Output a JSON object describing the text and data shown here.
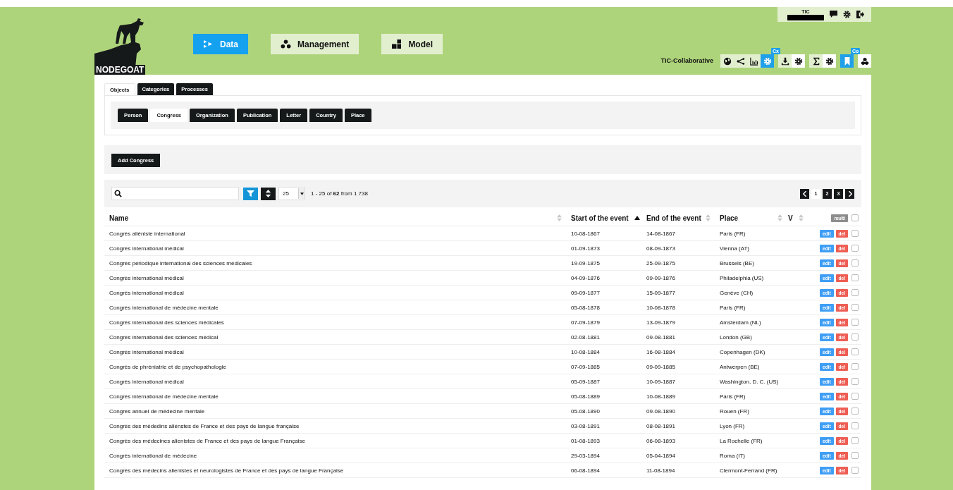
{
  "logo": "NODEGOAT",
  "user": {
    "name": "TIC"
  },
  "nav": [
    {
      "label": "Data",
      "kind": "data",
      "selected": true
    },
    {
      "label": "Management",
      "kind": "management",
      "selected": false
    },
    {
      "label": "Model",
      "kind": "model",
      "selected": false
    }
  ],
  "project": "TIC-Collaborative",
  "toolbar_groups": [
    [
      {
        "kind": "globe",
        "active": false
      },
      {
        "kind": "network",
        "active": false
      },
      {
        "kind": "chart",
        "active": false
      },
      {
        "kind": "gear",
        "active": true,
        "badge": "Cx"
      }
    ],
    [
      {
        "kind": "download",
        "active": false
      },
      {
        "kind": "gear",
        "active": false
      }
    ],
    [
      {
        "kind": "sigma",
        "active": false
      },
      {
        "kind": "gear",
        "active": false
      }
    ],
    [
      {
        "kind": "bookmark",
        "active": true,
        "badge": "Co"
      }
    ],
    [
      {
        "kind": "cubes",
        "active": false
      }
    ]
  ],
  "type_tabs": [
    {
      "label": "Objects",
      "selected": true
    },
    {
      "label": "Categories",
      "selected": false
    },
    {
      "label": "Processes",
      "selected": false
    }
  ],
  "object_tabs": [
    {
      "label": "Person",
      "selected": false
    },
    {
      "label": "Congress",
      "selected": true
    },
    {
      "label": "Organization",
      "selected": false
    },
    {
      "label": "Publication",
      "selected": false
    },
    {
      "label": "Letter",
      "selected": false
    },
    {
      "label": "Country",
      "selected": false
    },
    {
      "label": "Place",
      "selected": false
    }
  ],
  "add_button": "Add Congress",
  "page_size": "25",
  "result_summary": "1 - 25 of **62** from 1 738",
  "pages": [
    {
      "label": "1",
      "selected": true
    },
    {
      "label": "2",
      "selected": false
    },
    {
      "label": "3",
      "selected": false
    }
  ],
  "columns": [
    {
      "label": "Name",
      "sorted_ascending": false
    },
    {
      "label": "Start of the event",
      "sorted_ascending": true
    },
    {
      "label": "End of the event",
      "sorted_ascending": false
    },
    {
      "label": "Place",
      "sorted_ascending": false
    },
    {
      "label": "V",
      "sorted_ascending": false
    }
  ],
  "multi_button": "multi",
  "select_all_checked": false,
  "rows": [
    {
      "cells": [
        "Congrès aliéniste international",
        "10-08-1867",
        "14-08-1867",
        "Paris (FR)"
      ],
      "edit": "edit",
      "delete": "del",
      "checked": false
    },
    {
      "cells": [
        "Congrès international médical",
        "01-09-1873",
        "08-09-1873",
        "Vienna (AT)"
      ],
      "edit": "edit",
      "delete": "del",
      "checked": false
    },
    {
      "cells": [
        "Congrès périodique international des sciences médicales",
        "19-09-1875",
        "25-09-1875",
        "Brussels (BE)"
      ],
      "edit": "edit",
      "delete": "del",
      "checked": false
    },
    {
      "cells": [
        "Congrès international médical",
        "04-09-1876",
        "09-09-1876",
        "Philadelphia (US)"
      ],
      "edit": "edit",
      "delete": "del",
      "checked": false
    },
    {
      "cells": [
        "Congrès international médical",
        "09-09-1877",
        "15-09-1877",
        "Genève (CH)"
      ],
      "edit": "edit",
      "delete": "del",
      "checked": false
    },
    {
      "cells": [
        "Congrès international de médecine mentale",
        "05-08-1878",
        "10-08-1878",
        "Paris (FR)"
      ],
      "edit": "edit",
      "delete": "del",
      "checked": false
    },
    {
      "cells": [
        "Congrès international des sciences médicales",
        "07-09-1879",
        "13-09-1879",
        "Amsterdam (NL)"
      ],
      "edit": "edit",
      "delete": "del",
      "checked": false
    },
    {
      "cells": [
        "Congrès international des sciences médical",
        "02-08-1881",
        "09-08-1881",
        "London (GB)"
      ],
      "edit": "edit",
      "delete": "del",
      "checked": false
    },
    {
      "cells": [
        "Congrès international médical",
        "10-08-1884",
        "16-08-1884",
        "Copenhagen (DK)"
      ],
      "edit": "edit",
      "delete": "del",
      "checked": false
    },
    {
      "cells": [
        "Congrès de phréniatrie et de psychopathologie",
        "07-09-1885",
        "09-09-1885",
        "Antwerpen (BE)"
      ],
      "edit": "edit",
      "delete": "del",
      "checked": false
    },
    {
      "cells": [
        "Congrès international médical",
        "05-09-1887",
        "10-09-1887",
        "Washington, D. C. (US)"
      ],
      "edit": "edit",
      "delete": "del",
      "checked": false
    },
    {
      "cells": [
        "Congrès international de médecine mentale",
        "05-08-1889",
        "10-08-1889",
        "Paris (FR)"
      ],
      "edit": "edit",
      "delete": "del",
      "checked": false
    },
    {
      "cells": [
        "Congrès annuel de médecine mentale",
        "05-08-1890",
        "09-08-1890",
        "Rouen (FR)"
      ],
      "edit": "edit",
      "delete": "del",
      "checked": false
    },
    {
      "cells": [
        "Congrès des médedins aliénstes de France et des pays de langue française",
        "03-08-1891",
        "08-08-1891",
        "Lyon (FR)"
      ],
      "edit": "edit",
      "delete": "del",
      "checked": false
    },
    {
      "cells": [
        "Congrès des médecines alienistes de France et des pays de langue Française",
        "01-08-1893",
        "06-08-1893",
        "La Rochelle (FR)"
      ],
      "edit": "edit",
      "delete": "del",
      "checked": false
    },
    {
      "cells": [
        "Congrès international de médecine",
        "29-03-1894",
        "05-04-1894",
        "Roma (IT)"
      ],
      "edit": "edit",
      "delete": "del",
      "checked": false
    },
    {
      "cells": [
        "Congrès des médecins alienistes et neurologistes de France et des pays de langue Française",
        "06-08-1894",
        "11-08-1894",
        "Clermont-Ferrand (FR)"
      ],
      "edit": "edit",
      "delete": "del",
      "checked": false
    }
  ]
}
